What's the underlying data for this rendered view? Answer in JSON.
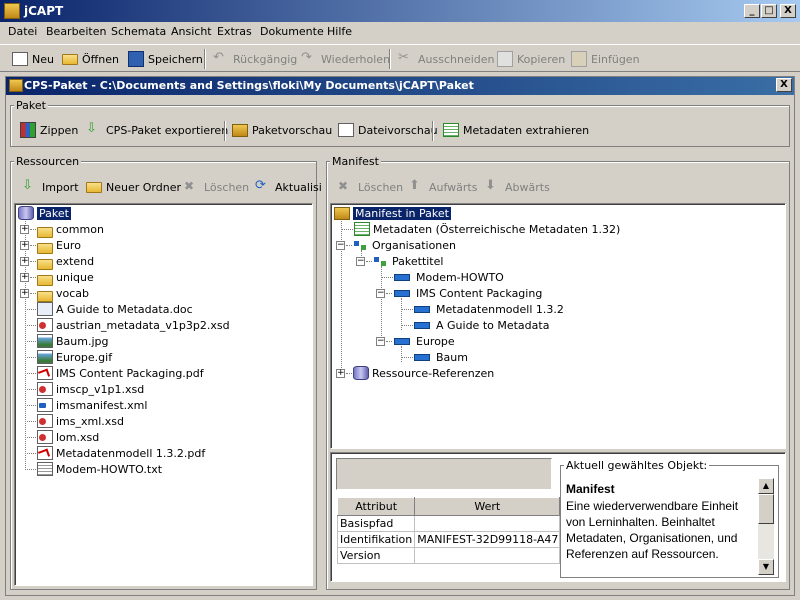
{
  "app": {
    "title": "jCAPT"
  },
  "window_buttons": {
    "minimize": "_",
    "maximize": "□",
    "close": "X"
  },
  "menu": [
    {
      "label": "Datei"
    },
    {
      "label": "Bearbeiten"
    },
    {
      "label": "Schemata"
    },
    {
      "label": "Ansicht"
    },
    {
      "label": "Extras"
    },
    {
      "label": "Dokumente"
    },
    {
      "label": "Hilfe"
    }
  ],
  "toolbar": {
    "new": "Neu",
    "open": "Öffnen",
    "save": "Speichern",
    "undo": "Rückgängig",
    "redo": "Wiederholen",
    "cut": "Ausschneiden",
    "copy": "Kopieren",
    "paste": "Einfügen"
  },
  "inner_window": {
    "title": "CPS-Paket - C:\\Documents and Settings\\floki\\My Documents\\jCAPT\\Paket",
    "close": "X"
  },
  "paket_group": {
    "label": "Paket",
    "buttons": {
      "zip": "Zippen",
      "export": "CPS-Paket exportieren",
      "preview_pkg": "Paketvorschau",
      "preview_file": "Dateivorschau",
      "extract_meta": "Metadaten extrahieren"
    }
  },
  "resources": {
    "label": "Ressourcen",
    "buttons": {
      "import": "Import",
      "new_folder": "Neuer Ordner",
      "delete": "Löschen",
      "refresh": "Aktualisi"
    },
    "root": "Paket",
    "folders": [
      "common",
      "Euro",
      "extend",
      "unique",
      "vocab"
    ],
    "files": [
      {
        "name": "A Guide to Metadata.doc",
        "icon": "doc-icon"
      },
      {
        "name": "austrian_metadata_v1p3p2.xsd",
        "icon": "xsd-icon"
      },
      {
        "name": "Baum.jpg",
        "icon": "image-icon"
      },
      {
        "name": "Europe.gif",
        "icon": "image-icon"
      },
      {
        "name": "IMS Content Packaging.pdf",
        "icon": "pdf-icon"
      },
      {
        "name": "imscp_v1p1.xsd",
        "icon": "xsd-icon"
      },
      {
        "name": "imsmanifest.xml",
        "icon": "xml-icon"
      },
      {
        "name": "ims_xml.xsd",
        "icon": "xsd-icon"
      },
      {
        "name": "lom.xsd",
        "icon": "xsd-icon"
      },
      {
        "name": "Metadatenmodell 1.3.2.pdf",
        "icon": "pdf-icon"
      },
      {
        "name": "Modem-HOWTO.txt",
        "icon": "text-icon"
      }
    ]
  },
  "manifest": {
    "label": "Manifest",
    "buttons": {
      "delete": "Löschen",
      "up": "Aufwärts",
      "down": "Abwärts"
    },
    "tree": {
      "root": "Manifest in Paket",
      "metadata": "Metadaten (Österreichische Metadaten 1.32)",
      "organisations": "Organisationen",
      "package_title": "Pakettitel",
      "modem": "Modem-HOWTO",
      "ims": "IMS Content Packaging",
      "metamodel": "Metadatenmodell 1.3.2",
      "guide": "A Guide to Metadata",
      "europe": "Europe",
      "baum": "Baum",
      "resource_refs": "Ressource-Referenzen"
    }
  },
  "attributes": {
    "headers": {
      "attribute": "Attribut",
      "value": "Wert"
    },
    "rows": [
      {
        "key": "Basispfad",
        "value": ""
      },
      {
        "key": "Identifikation",
        "value": "MANIFEST-32D99118-A47..."
      },
      {
        "key": "Version",
        "value": ""
      }
    ]
  },
  "info": {
    "label": "Aktuell gewähltes Objekt:",
    "title": "Manifest",
    "description": "Eine wiederverwendbare Einheit von Lerninhalten. Beinhaltet Metadaten, Organisationen, und Referenzen auf Ressourcen."
  }
}
